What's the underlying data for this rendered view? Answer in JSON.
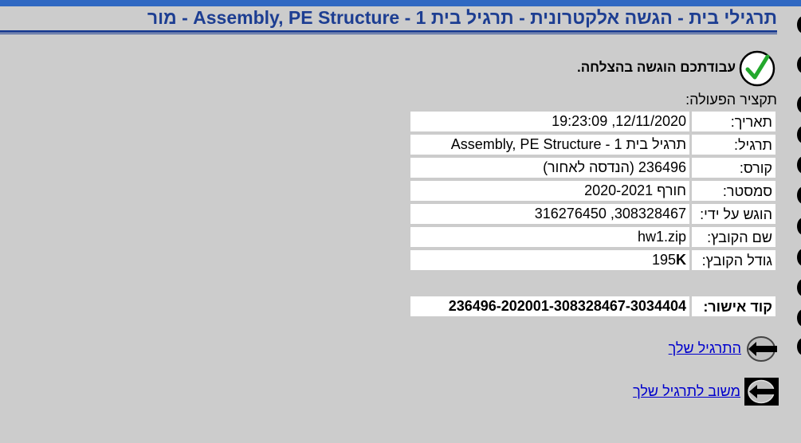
{
  "page": {
    "title": "תרגילי בית - הגשה אלקטרונית - תרגיל בית 1 - Assembly, PE Structure - מור"
  },
  "confirmation": {
    "success_message": "עבודתכם הוגשה בהצלחה.",
    "summary_heading": "תקציר הפעולה:"
  },
  "details": [
    {
      "label": "תאריך:",
      "value": "12/11/2020, 19:23:09"
    },
    {
      "label": "תרגיל:",
      "value": "תרגיל בית 1 - Assembly, PE Structure"
    },
    {
      "label": "קורס:",
      "value": "236496 (הנדסה לאחור)"
    },
    {
      "label": "סמסטר:",
      "value": "חורף 2020-2021"
    },
    {
      "label": "הוגש על ידי:",
      "value": "308328467, 316276450"
    },
    {
      "label": "שם הקובץ:",
      "value": "hw1.zip"
    },
    {
      "label": "גודל הקובץ:",
      "value": "195",
      "unit": "K"
    }
  ],
  "approval": {
    "label": "קוד אישור:",
    "value": "236496-202001-308328467-3034404"
  },
  "links": {
    "your_exercise": "התרגיל שלך",
    "feedback": "משוב לתרגיל שלך"
  },
  "icons": {
    "check": "check-circle-icon",
    "arrow": "arrow-left-icon",
    "arrow_boxed": "arrow-left-box-icon"
  },
  "colors": {
    "background": "#cccccc",
    "title": "#1d3e92",
    "top_bar": "#2f68c2",
    "check": "#22a82c",
    "link": "#0000cc"
  }
}
